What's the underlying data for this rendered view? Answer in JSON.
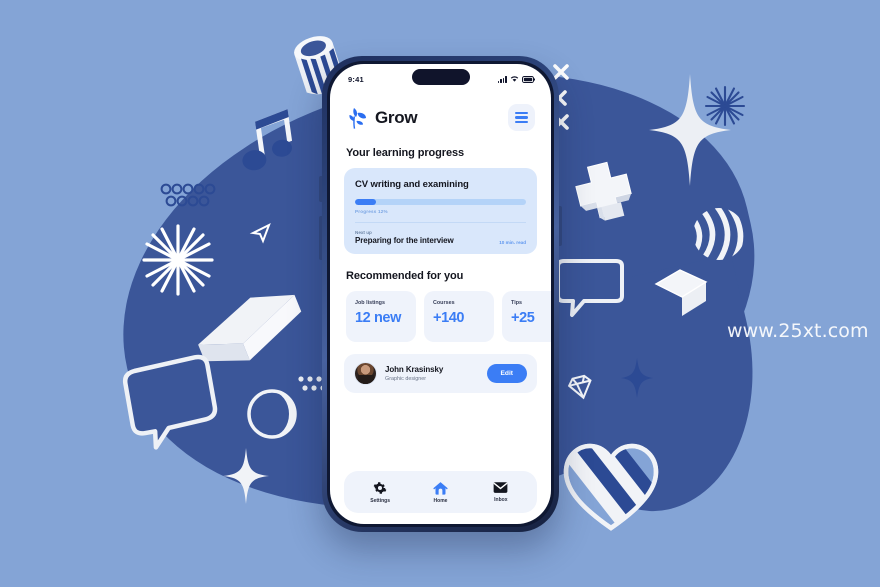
{
  "background": {
    "base_color": "#84a4d6",
    "blob_color": "#3b5699",
    "watermark": "www.25xt.com",
    "decorations": [
      "striped-cylinder-icon",
      "music-note-icon",
      "dot-grid-icon",
      "starburst-icon",
      "paper-plane-icon",
      "three-d-box-icon",
      "speech-bubble-icon",
      "crescent-moon-icon",
      "four-point-star-icon",
      "x-mark-icon",
      "three-d-plus-icon",
      "striped-sphere-icon",
      "three-d-cube-icon",
      "diamond-icon",
      "striped-heart-icon",
      "small-star-icon",
      "spark-icon"
    ]
  },
  "phone": {
    "status_bar": {
      "time": "9:41",
      "signal_icon": "cellular-signal-icon",
      "wifi_icon": "wifi-icon",
      "battery_icon": "battery-full-icon"
    },
    "app": {
      "brand": {
        "logo_icon": "leaf-sprout-icon",
        "name": "Grow"
      },
      "menu_button": {
        "icon": "hamburger-menu-icon",
        "label": "Menu"
      },
      "learning_section": {
        "title": "Your learning progress",
        "card": {
          "title": "CV writing and examining",
          "progress_label": "Progress  12%",
          "progress_percent": 12,
          "next_up_kicker": "Next up",
          "next_up_title": "Preparing for the interview",
          "read_time": "10 min. read"
        }
      },
      "recommended_section": {
        "title": "Recommended for you",
        "cards": [
          {
            "label": "Job listings",
            "value": "12 new"
          },
          {
            "label": "Courses",
            "value": "+140"
          },
          {
            "label": "Tips",
            "value": "+25"
          }
        ]
      },
      "profile": {
        "avatar_icon": "user-avatar",
        "name": "John Krasinsky",
        "role": "Graphic designer",
        "edit_label": "Edit"
      },
      "tab_bar": {
        "tabs": [
          {
            "label": "Settings",
            "icon": "gear-icon",
            "active": false
          },
          {
            "label": "Home",
            "icon": "home-icon",
            "active": true
          },
          {
            "label": "Inbox",
            "icon": "envelope-icon",
            "active": false
          }
        ]
      }
    }
  },
  "colors": {
    "accent": "#3b7df5",
    "dark_blue": "#3b5699",
    "light_bg": "#84a4d6",
    "card_blue": "#d9e7fb",
    "card_grey": "#eff3fb",
    "text_dark": "#14161f"
  }
}
